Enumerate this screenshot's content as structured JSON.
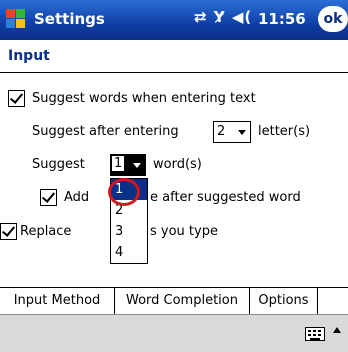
{
  "titlebar": {
    "app_title": "Settings",
    "status_icons": "⇄ Y̷ ◀(",
    "clock": "11:56",
    "ok_label": "ok"
  },
  "page": {
    "title": "Input"
  },
  "options": {
    "suggest_words": {
      "label": "Suggest words when entering text",
      "checked": true
    },
    "suggest_after_prefix": "Suggest after entering",
    "suggest_after_value": "2",
    "suggest_after_suffix": "letter(s)",
    "suggest_count_prefix": "Suggest",
    "suggest_count_value": "1",
    "suggest_count_suffix": "word(s)",
    "add_space": {
      "label_start": "Add",
      "label_end": "e after suggested word",
      "checked": true
    },
    "replace": {
      "label_start": "Replace",
      "label_end": "s you type",
      "checked": true
    }
  },
  "dropdown": {
    "options": [
      "1",
      "2",
      "3",
      "4"
    ],
    "selected": "1"
  },
  "tabs": [
    {
      "label": "Input Method",
      "active": false
    },
    {
      "label": "Word Completion",
      "active": true
    },
    {
      "label": "Options",
      "active": false
    }
  ],
  "colors": {
    "titlebar": "#0f3fa6",
    "selection": "#0a2f86",
    "tap_indicator": "#d0181d"
  },
  "icons": {
    "start": "windows-flag-icon",
    "connectivity": "sync-icon",
    "signal": "signal-off-icon",
    "volume": "speaker-icon",
    "keyboard": "keyboard-icon",
    "sip": "up-arrow-icon"
  }
}
